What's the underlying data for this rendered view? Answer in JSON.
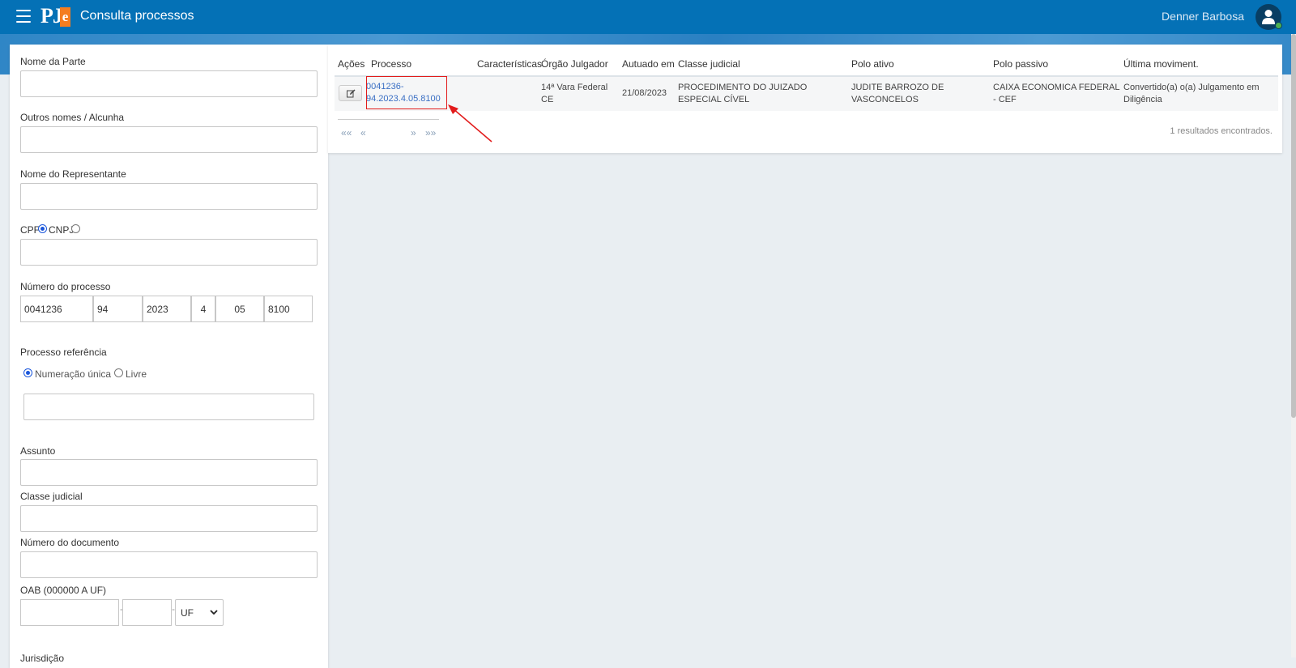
{
  "header": {
    "title": "Consulta processos",
    "user_name": "Denner Barbosa",
    "logo_text": "PJ",
    "logo_accent": "e"
  },
  "form": {
    "nome_parte_label": "Nome da Parte",
    "nome_parte_value": "",
    "outros_nomes_label": "Outros nomes / Alcunha",
    "outros_nomes_value": "",
    "representante_label": "Nome do Representante",
    "representante_value": "",
    "cpf_label": "CPF",
    "cnpj_label": "CNPJ",
    "doc_type_selected": "CPF",
    "doc_value": "",
    "numero_label": "Número do processo",
    "numero_parts": [
      "0041236",
      "94",
      "2023",
      "4",
      "05",
      "8100"
    ],
    "referencia_label": "Processo referência",
    "ref_option_unica": "Numeração única",
    "ref_option_livre": "Livre",
    "ref_selected": "Numeração única",
    "ref_value": "",
    "assunto_label": "Assunto",
    "assunto_value": "",
    "classe_label": "Classe judicial",
    "classe_value": "",
    "documento_label": "Número do documento",
    "documento_value": "",
    "oab_label": "OAB (000000 A UF)",
    "oab_number": "",
    "oab_letter": "",
    "oab_uf": "UF",
    "next_label_partial": "Jurisdição"
  },
  "results": {
    "headers": [
      "Ações",
      "Processo",
      "Características",
      "Órgão Julgador",
      "Autuado em",
      "Classe judicial",
      "Polo ativo",
      "Polo passivo",
      "Última moviment."
    ],
    "rows": [
      {
        "processo_line1": "0041236-",
        "processo_line2": "94.2023.4.05.8100",
        "caracteristicas": "",
        "orgao_line1": "14ª Vara Federal",
        "orgao_line2": "CE",
        "autuado": "21/08/2023",
        "classe_line1": "PROCEDIMENTO DO JUIZADO",
        "classe_line2": "ESPECIAL CÍVEL",
        "ativo_line1": "JUDITE BARROZO DE",
        "ativo_line2": "VASCONCELOS",
        "passivo_line1": "CAIXA ECONOMICA FEDERAL",
        "passivo_line2": "- CEF",
        "mov_line1": "Convertido(a) o(a) Julgamento em",
        "mov_line2": "Diligência"
      }
    ],
    "pager": {
      "first": "««",
      "prev": "«",
      "next": "»",
      "last": "»»"
    },
    "count_text": "1 resultados encontrados."
  },
  "colors": {
    "header_bg": "#0471b6",
    "link": "#3a6fc4",
    "highlight": "#e21b1b",
    "logo_accent": "#f47d20"
  },
  "icons": [
    "menu-icon",
    "user-icon",
    "edit-icon",
    "arrow-annotation",
    "chevron-down-icon"
  ]
}
